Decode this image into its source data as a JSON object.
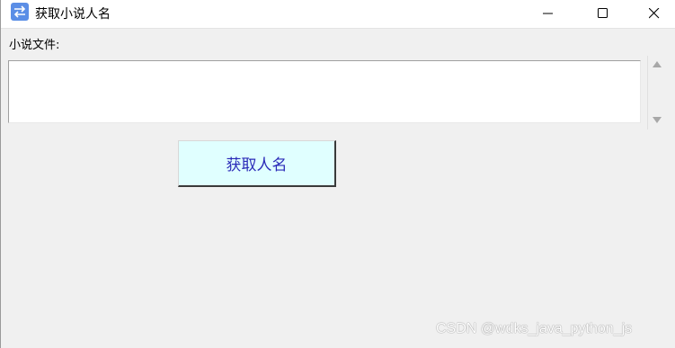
{
  "window": {
    "title": "获取小说人名",
    "icon": "swap-arrows-icon"
  },
  "form": {
    "file_label": "小说文件:",
    "file_value": ""
  },
  "actions": {
    "extract_label": "获取人名"
  },
  "watermark": {
    "text": "CSDN @wdks_java_python_js"
  },
  "colors": {
    "button_bg": "#e0ffff",
    "button_text": "#2a2ab8",
    "window_bg": "#f0f0f0",
    "icon_bg": "#5b8ee6"
  }
}
